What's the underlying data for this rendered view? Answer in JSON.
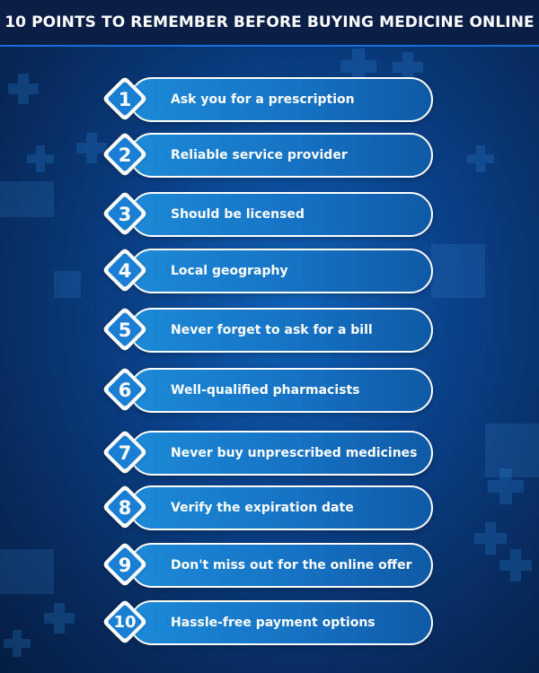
{
  "title": "10 POINTS TO REMEMBER BEFORE BUYING MEDICINE ONLINE",
  "icons": {
    "badge": "diamond-badge",
    "background": "medical-cross-icon"
  },
  "colors": {
    "title_bar": "#0a1e46",
    "accent": "#1a7fd4",
    "background": "#0a3f86"
  },
  "points": [
    {
      "number": "1",
      "text": "Ask you for a prescription"
    },
    {
      "number": "2",
      "text": "Reliable service provider"
    },
    {
      "number": "3",
      "text": "Should be licensed"
    },
    {
      "number": "4",
      "text": "Local geography"
    },
    {
      "number": "5",
      "text": "Never forget to ask for a bill"
    },
    {
      "number": "6",
      "text": "Well-qualified pharmacists"
    },
    {
      "number": "7",
      "text": "Never buy unprescribed medicines"
    },
    {
      "number": "8",
      "text": "Verify the expiration date"
    },
    {
      "number": "9",
      "text": "Don't miss out for the online offer"
    },
    {
      "number": "10",
      "text": "Hassle-free payment options"
    }
  ]
}
